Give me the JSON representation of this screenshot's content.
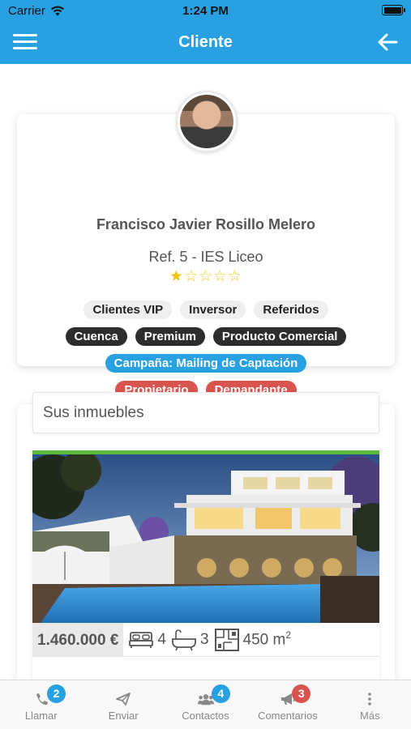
{
  "status_bar": {
    "carrier": "Carrier",
    "time": "1:24 PM"
  },
  "nav": {
    "title": "Cliente"
  },
  "client": {
    "name": "Francisco Javier Rosillo Melero",
    "ref": "Ref. 5 - IES Liceo",
    "rating": {
      "value": 1,
      "max": 5
    }
  },
  "tags": {
    "row1": [
      "Clientes VIP",
      "Inversor",
      "Referidos"
    ],
    "row2": [
      "Cuenca",
      "Premium",
      "Producto Comercial"
    ],
    "row3": [
      "Campaña: Mailing de Captación"
    ],
    "row4": [
      "Propietario",
      "Demandante"
    ]
  },
  "properties": {
    "header": "Sus inmuebles",
    "items": [
      {
        "price": "1.460.000 €",
        "bedrooms": "4",
        "bathrooms": "3",
        "area": "450 m",
        "area_sup": "2"
      }
    ]
  },
  "tabs": [
    {
      "label": "Llamar",
      "icon": "phone-icon",
      "badge": "2",
      "badge_color": "#28a1e2"
    },
    {
      "label": "Enviar",
      "icon": "send-icon",
      "badge": "",
      "badge_color": ""
    },
    {
      "label": "Contactos",
      "icon": "users-icon",
      "badge": "4",
      "badge_color": "#28a1e2"
    },
    {
      "label": "Comentarios",
      "icon": "megaphone-icon",
      "badge": "3",
      "badge_color": "#d9534f"
    },
    {
      "label": "Más",
      "icon": "more-icon",
      "badge": "",
      "badge_color": ""
    }
  ],
  "colors": {
    "accent": "#28a1e2",
    "status_green": "#5bb93f",
    "danger": "#d9534f",
    "dark": "#2d2d2d"
  }
}
